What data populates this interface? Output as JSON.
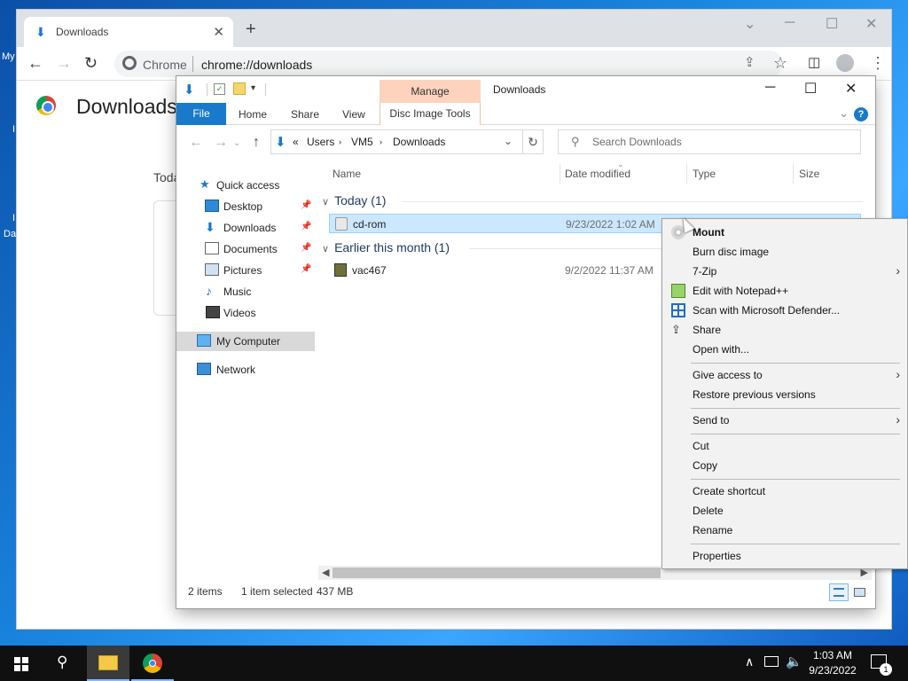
{
  "desktop": {
    "labels": [
      "My",
      "I",
      "I",
      "Da"
    ]
  },
  "chrome": {
    "tab_title": "Downloads",
    "site_label": "Chrome",
    "url": "chrome://downloads",
    "page_title": "Downloads",
    "section_today": "Toda"
  },
  "explorer": {
    "title": "Downloads",
    "manage_label": "Manage",
    "ribbon": {
      "file": "File",
      "home": "Home",
      "share": "Share",
      "view": "View",
      "disc_image_tools": "Disc Image Tools"
    },
    "breadcrumb": [
      "«",
      "Users",
      "VM5",
      "Downloads"
    ],
    "search_placeholder": "Search Downloads",
    "nav": {
      "quick_access": "Quick access",
      "desktop": "Desktop",
      "downloads": "Downloads",
      "documents": "Documents",
      "pictures": "Pictures",
      "music": "Music",
      "videos": "Videos",
      "my_computer": "My Computer",
      "network": "Network"
    },
    "columns": {
      "name": "Name",
      "date_modified": "Date modified",
      "type": "Type",
      "size": "Size"
    },
    "groups": {
      "today": "Today (1)",
      "earlier": "Earlier this month (1)"
    },
    "files": [
      {
        "name": "cd-rom",
        "date": "9/23/2022 1:02 AM"
      },
      {
        "name": "vac467",
        "date": "9/2/2022 11:37 AM"
      }
    ],
    "status": {
      "items": "2 items",
      "selected": "1 item selected",
      "size": "437 MB"
    }
  },
  "context_menu": {
    "mount": "Mount",
    "burn": "Burn disc image",
    "zip": "7-Zip",
    "notepad": "Edit with Notepad++",
    "defender": "Scan with Microsoft Defender...",
    "share": "Share",
    "open_with": "Open with...",
    "give_access": "Give access to",
    "restore": "Restore previous versions",
    "send_to": "Send to",
    "cut": "Cut",
    "copy": "Copy",
    "create_shortcut": "Create shortcut",
    "delete": "Delete",
    "rename": "Rename",
    "properties": "Properties"
  },
  "taskbar": {
    "time": "1:03 AM",
    "date": "9/23/2022",
    "notification_count": "1"
  },
  "colors": {
    "accent": "#1979ca",
    "manage_tab": "#fdd3bd",
    "selection": "#cce8ff"
  }
}
